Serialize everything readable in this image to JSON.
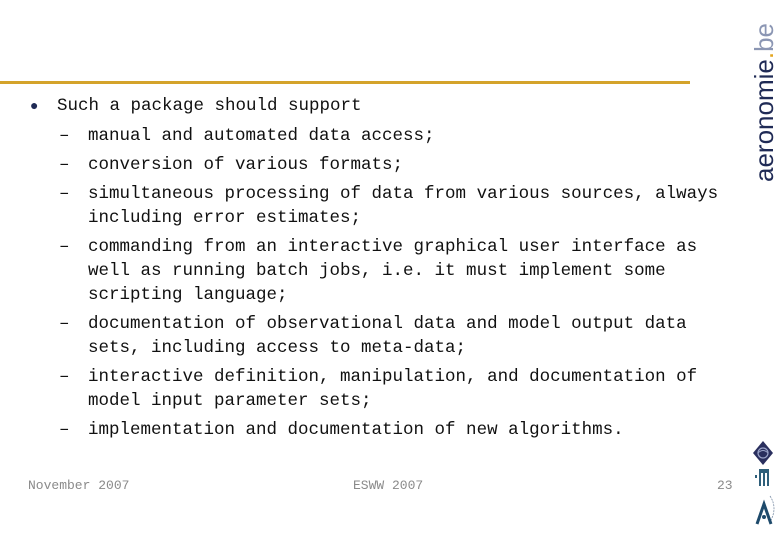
{
  "brand": {
    "name": "aeronomie",
    "dot": ".",
    "tld": "be"
  },
  "content": {
    "bullet": "Such a package should support",
    "sub_items": [
      {
        "dash": "–",
        "text": "manual and automated data access;"
      },
      {
        "dash": "–",
        "text": "conversion of various formats;"
      },
      {
        "dash": "–",
        "text": "simultaneous processing of data from various sources, always including error estimates;"
      },
      {
        "dash": "–",
        "text": "commanding from an interactive graphical user interface as well as running batch jobs, i.e. it must implement some scripting language;"
      },
      {
        "dash": "–",
        "text": "documentation of observational data and model output data sets, including access to meta-data;"
      },
      {
        "dash": "–",
        "text": "interactive definition, manipulation, and documentation of model input parameter sets;"
      },
      {
        "dash": "–",
        "text": "implementation and documentation of new algorithms."
      }
    ]
  },
  "footer": {
    "date": "November 2007",
    "event": "ESWW 2007",
    "page_number": "23"
  },
  "logos": [
    "globe-diamond-logo",
    "building-logo",
    "antenna-a-logo"
  ],
  "colors": {
    "accent_rule": "#d4a32a",
    "brand_navy": "#1f2a55",
    "footer_gray": "#8a8a8a"
  }
}
